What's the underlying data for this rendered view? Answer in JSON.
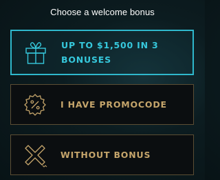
{
  "header": {
    "title": "Choose a welcome bonus"
  },
  "options": [
    {
      "label": "UP TO $1,500 IN 3 BONUSES",
      "icon": "gift-icon",
      "selected": true,
      "color": "#36c8dc"
    },
    {
      "label": "I HAVE PROMOCODE",
      "icon": "discount-badge-icon",
      "selected": false,
      "color": "#c5a56b"
    },
    {
      "label": "WITHOUT BONUS",
      "icon": "no-bonus-x-icon",
      "selected": false,
      "color": "#c5a56b"
    }
  ],
  "colors": {
    "accent": "#36c8dc",
    "gold": "#c5a56b",
    "border_gold": "#5c4e34",
    "background": "#0c1c20"
  }
}
